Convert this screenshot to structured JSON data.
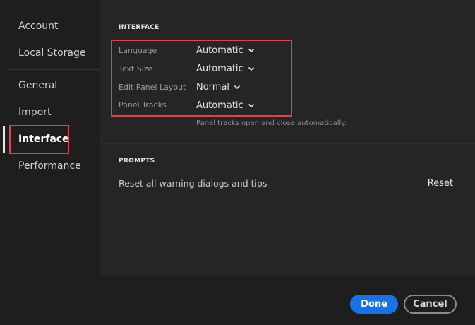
{
  "sidebar": {
    "items": [
      {
        "label": "Account"
      },
      {
        "label": "Local Storage"
      },
      {
        "label": "General"
      },
      {
        "label": "Import"
      },
      {
        "label": "Interface"
      },
      {
        "label": "Performance"
      }
    ],
    "selected": "Interface"
  },
  "interface_section": {
    "title": "INTERFACE",
    "rows": [
      {
        "label": "Language",
        "value": "Automatic"
      },
      {
        "label": "Text Size",
        "value": "Automatic"
      },
      {
        "label": "Edit Panel Layout",
        "value": "Normal"
      },
      {
        "label": "Panel Tracks",
        "value": "Automatic"
      }
    ],
    "hint": "Panel tracks open and close automatically."
  },
  "prompts_section": {
    "title": "PROMPTS",
    "text": "Reset all warning dialogs and tips",
    "reset_label": "Reset"
  },
  "footer": {
    "done_label": "Done",
    "cancel_label": "Cancel"
  },
  "colors": {
    "accent": "#1473e6",
    "highlight": "#e0414a"
  }
}
